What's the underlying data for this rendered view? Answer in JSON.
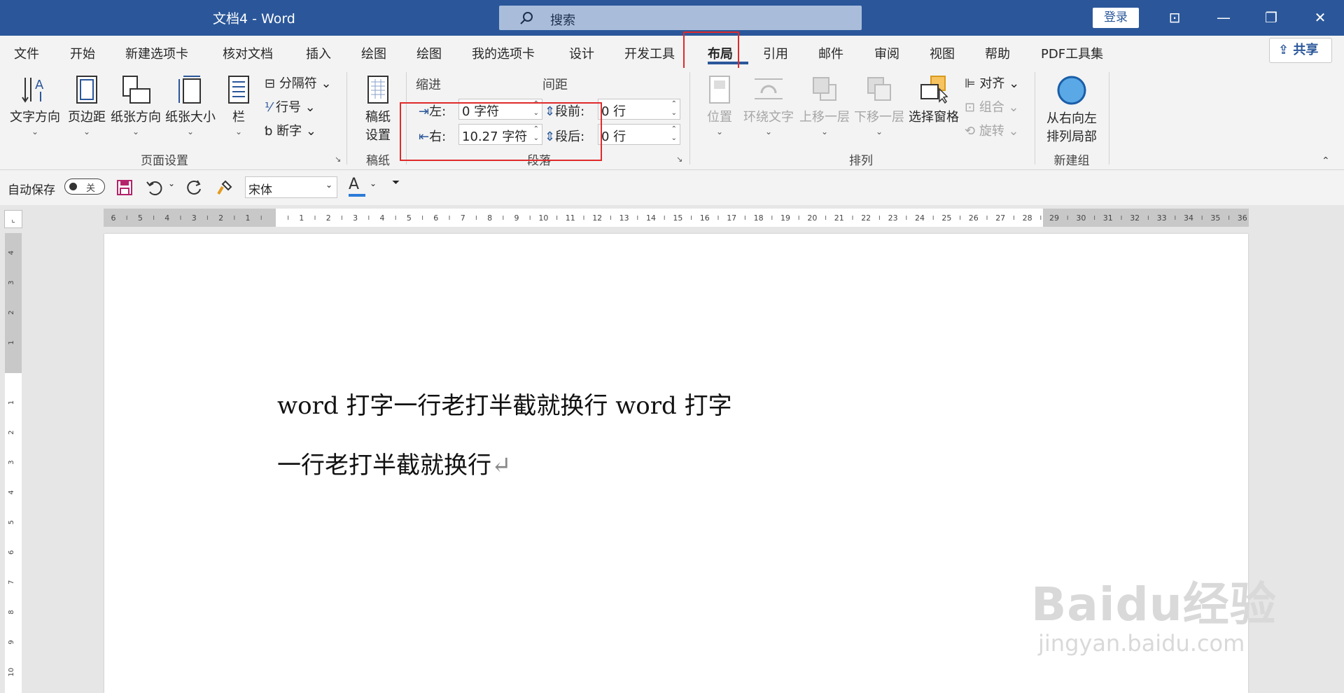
{
  "window": {
    "title": "文档4  -  Word",
    "search_placeholder": "搜索",
    "signin": "登录",
    "controls": [
      "⊡",
      "—",
      "❐",
      "✕"
    ]
  },
  "tabs": [
    "文件",
    "开始",
    "新建选项卡",
    "核对文档",
    "插入",
    "绘图",
    "绘图",
    "我的选项卡",
    "设计",
    "开发工具",
    "布局",
    "引用",
    "邮件",
    "审阅",
    "视图",
    "帮助",
    "PDF工具集"
  ],
  "active_tab": "布局",
  "share_label": "共享",
  "ribbon": {
    "page_setup": {
      "buttons": [
        "文字方向",
        "页边距",
        "纸张方向",
        "纸张大小",
        "栏"
      ],
      "small": [
        "分隔符",
        "行号",
        "断字"
      ],
      "group": "页面设置"
    },
    "manuscript": {
      "button_line1": "稿纸",
      "button_line2": "设置",
      "group": "稿纸"
    },
    "paragraph": {
      "indent_heading": "缩进",
      "spacing_heading": "间距",
      "left_label": "左:",
      "left_value": "0 字符",
      "right_label": "右:",
      "right_value": "10.27 字符",
      "before_label": "段前:",
      "before_value": "0 行",
      "after_label": "段后:",
      "after_value": "0 行",
      "group": "段落"
    },
    "arrange": {
      "buttons": [
        "位置",
        "环绕文字",
        "上移一层",
        "下移一层",
        "选择窗格"
      ],
      "small": [
        "对齐",
        "组合",
        "旋转"
      ],
      "group": "排列"
    },
    "new_group": {
      "button_line1": "从右向左",
      "button_line2": "排列局部",
      "group": "新建组"
    }
  },
  "qat": {
    "autosave_label": "自动保存",
    "autosave_state": "关",
    "font_name": "宋体"
  },
  "ruler": {
    "top_numbers": [
      "6",
      "5",
      "4",
      "3",
      "2",
      "1",
      "",
      "1",
      "2",
      "3",
      "4",
      "5",
      "6",
      "7",
      "8",
      "9",
      "10",
      "11",
      "12",
      "13",
      "14",
      "15",
      "16",
      "17",
      "18",
      "19",
      "20",
      "21",
      "22",
      "23",
      "24",
      "25",
      "26",
      "27",
      "28",
      "29",
      "30",
      "31",
      "32",
      "33",
      "34",
      "35",
      "36"
    ],
    "left_numbers": [
      "4",
      "3",
      "2",
      "1",
      "",
      "1",
      "2",
      "3",
      "4",
      "5",
      "6",
      "7",
      "8",
      "9",
      "10"
    ]
  },
  "document": {
    "line1": "word 打字一行老打半截就换行 word 打字",
    "line2": "一行老打半截就换行",
    "para_mark": "↵"
  },
  "watermark": {
    "brand": "Baidu经验",
    "url": "jingyan.baidu.com"
  },
  "colors": {
    "title_bar": "#2b579a",
    "highlight": "#e02a2a",
    "accent": "#2b579a"
  }
}
